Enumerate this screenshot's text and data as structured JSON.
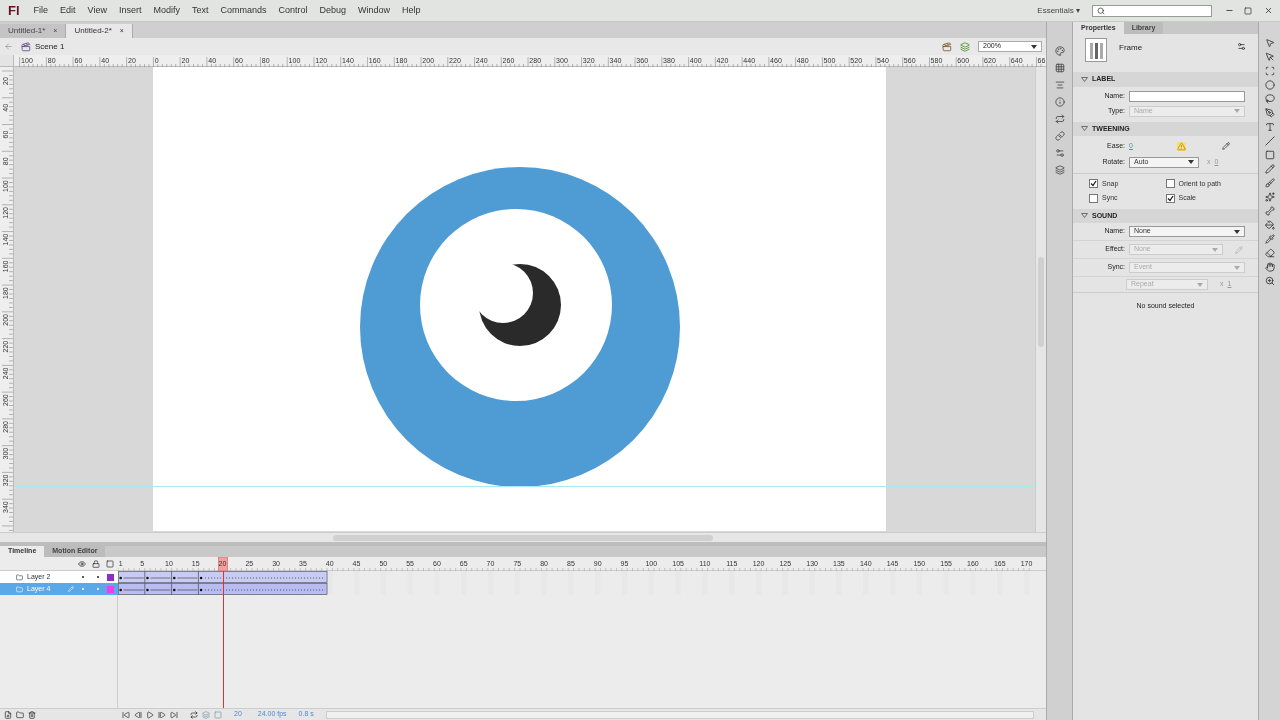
{
  "menu_bar": {
    "logo": "Fl",
    "items": [
      "File",
      "Edit",
      "View",
      "Insert",
      "Modify",
      "Text",
      "Commands",
      "Control",
      "Debug",
      "Window",
      "Help"
    ],
    "workspace": "Essentials",
    "workspace_caret": "▾"
  },
  "document_tabs": [
    {
      "label": "Untitled-1*",
      "close": "×",
      "selected": false
    },
    {
      "label": "Untitled-2*",
      "close": "×",
      "selected": true
    }
  ],
  "edit_bar": {
    "scene": "Scene 1",
    "zoom": "200%"
  },
  "rulers": {
    "horizontal": [
      "100",
      "80",
      "60",
      "40",
      "20",
      "0",
      "20",
      "40",
      "60",
      "80",
      "100",
      "120",
      "140",
      "160",
      "180",
      "200",
      "220",
      "240",
      "260",
      "280",
      "300",
      "320",
      "340",
      "360",
      "380",
      "400",
      "420",
      "440",
      "460",
      "480",
      "500",
      "520",
      "540",
      "560",
      "580",
      "600",
      "620",
      "640",
      "66"
    ],
    "vertical": [
      "20",
      "40",
      "60",
      "80",
      "100",
      "120",
      "140",
      "160",
      "180",
      "200",
      "220",
      "240",
      "260",
      "280",
      "300",
      "320",
      "340"
    ]
  },
  "properties": {
    "tabs": [
      {
        "label": "Properties",
        "selected": true
      },
      {
        "label": "Library",
        "selected": false
      }
    ],
    "object": "Frame",
    "label_section": {
      "title": "LABEL",
      "name": {
        "label": "Name:",
        "disabled": false
      },
      "type": {
        "label": "Type:",
        "value": "Name",
        "disabled": true
      }
    },
    "tweening": {
      "title": "TWEENING",
      "ease_label": "Ease:",
      "ease_value": "0",
      "rotate": {
        "label": "Rotate:",
        "value": "Auto",
        "disabled": false
      },
      "rotate_times": "x",
      "rotate_count": "0",
      "checks": [
        {
          "label": "Snap",
          "checked": true
        },
        {
          "label": "Orient to path",
          "checked": false
        },
        {
          "label": "Sync",
          "checked": false
        },
        {
          "label": "Scale",
          "checked": true
        }
      ]
    },
    "sound": {
      "title": "SOUND",
      "fields": [
        {
          "label": "Name:",
          "value": "None",
          "disabled": false
        },
        {
          "label": "Effect:",
          "value": "None",
          "disabled": true
        },
        {
          "label": "Sync:",
          "value": "Event",
          "disabled": true
        }
      ],
      "repeat": {
        "value": "Repeat",
        "disabled": true
      },
      "repeat_times": "x",
      "repeat_count": "1",
      "status": "No sound selected"
    }
  },
  "timeline": {
    "tabs": [
      {
        "label": "Timeline",
        "selected": true
      },
      {
        "label": "Motion Editor",
        "selected": false
      }
    ],
    "frame_numbers": [
      "1",
      "5",
      "10",
      "15",
      "20",
      "25",
      "30",
      "35",
      "40",
      "45",
      "50",
      "55",
      "60",
      "65",
      "70",
      "75",
      "80",
      "85",
      "90",
      "95",
      "100",
      "105",
      "110",
      "115",
      "120",
      "125",
      "130",
      "135",
      "140",
      "145",
      "150",
      "155",
      "160",
      "165",
      "170"
    ],
    "layers": [
      {
        "name": "Layer 2",
        "selected": false,
        "color": "#8a2fc8"
      },
      {
        "name": "Layer 4",
        "selected": true,
        "color": "#f03cf0"
      }
    ],
    "status": {
      "frame": "20",
      "fps": "24.00 fps",
      "time": "0.8 s"
    }
  }
}
